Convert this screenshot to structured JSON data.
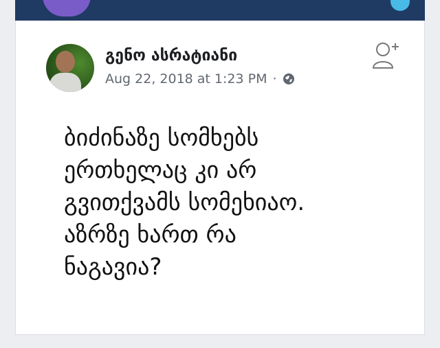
{
  "header": {
    "author_name": "გენო ასრატიანი",
    "timestamp": "Aug 22, 2018 at 1:23 PM",
    "separator": "·",
    "privacy_icon": "globe-icon",
    "add_friend_icon": "add-friend-icon"
  },
  "post": {
    "text": "ბიძინაზე სომხებს\nერთხელაც კი არ\nგვითქვამს სომეხიაო.\nაზრზე ხართ რა\nნაგავია?"
  },
  "colors": {
    "banner": "#1f3a63",
    "name_text": "#1c1e21",
    "meta_text": "#616770"
  }
}
